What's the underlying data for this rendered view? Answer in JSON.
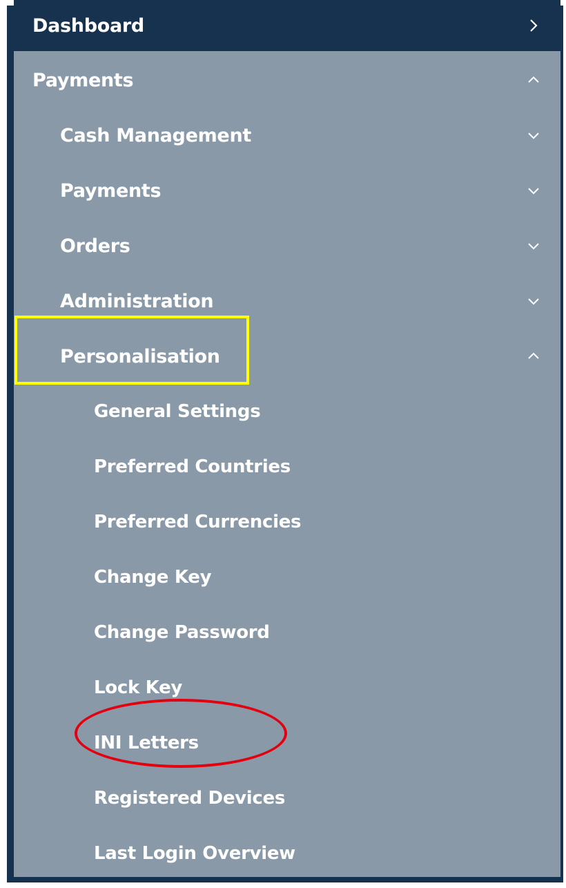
{
  "nav": {
    "dashboard": {
      "label": "Dashboard",
      "icon": "chevron-right-icon"
    },
    "payments": {
      "label": "Payments",
      "expanded": true,
      "icon": "chevron-up-icon"
    },
    "cash_management": {
      "label": "Cash Management",
      "icon": "chevron-down-icon"
    },
    "payments_sub": {
      "label": "Payments",
      "icon": "chevron-down-icon"
    },
    "orders": {
      "label": "Orders",
      "icon": "chevron-down-icon"
    },
    "administration": {
      "label": "Administration",
      "icon": "chevron-down-icon"
    },
    "personalisation": {
      "label": "Personalisation",
      "expanded": true,
      "icon": "chevron-up-icon",
      "items": [
        {
          "label": "General Settings"
        },
        {
          "label": "Preferred Countries"
        },
        {
          "label": "Preferred Currencies"
        },
        {
          "label": "Change Key"
        },
        {
          "label": "Change Password"
        },
        {
          "label": "Lock Key"
        },
        {
          "label": "INI Letters"
        },
        {
          "label": "Registered Devices"
        },
        {
          "label": "Last Login Overview"
        }
      ]
    }
  },
  "annotations": {
    "box_color": "#ffff00",
    "oval_color": "#e3000f"
  },
  "colors": {
    "sidebar_bg": "#8a99a8",
    "header_bg": "#17324f",
    "text": "#ffffff"
  }
}
